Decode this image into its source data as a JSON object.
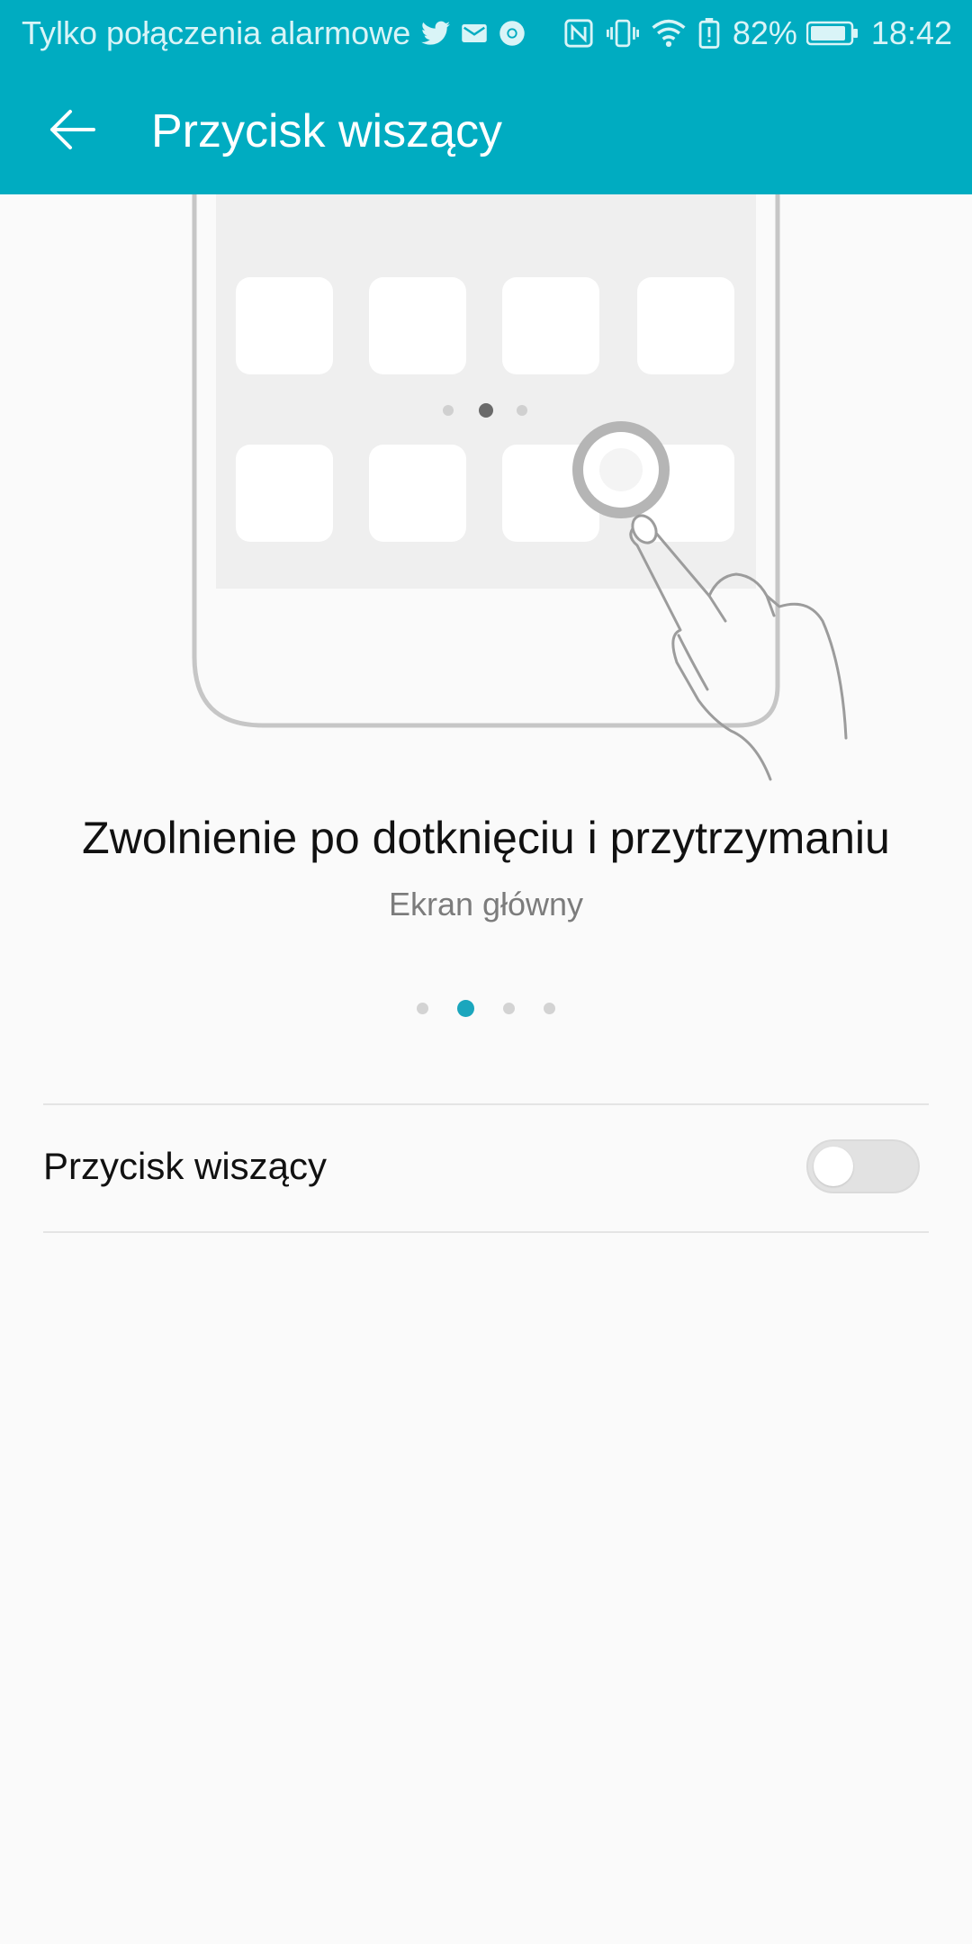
{
  "status_bar": {
    "carrier_text": "Tylko połączenia alarmowe",
    "battery_text": "82%",
    "time": "18:42",
    "left_icons": [
      "twitter-icon",
      "mail-icon",
      "chrome-icon"
    ],
    "right_icons": [
      "nfc-icon",
      "vibrate-icon",
      "wifi-icon",
      "battery-alert-icon",
      "battery-icon"
    ]
  },
  "app_bar": {
    "title": "Przycisk wiszący",
    "back_icon": "arrow-back-icon",
    "color": "#00acc1"
  },
  "intro": {
    "headline": "Zwolnienie po dotknięciu i przytrzymaniu",
    "subline": "Ekran główny",
    "pages": 4,
    "active_page": 2,
    "illustration_pages": 3,
    "illustration_active_page": 2
  },
  "setting": {
    "label": "Przycisk wiszący",
    "enabled": false
  },
  "colors": {
    "accent": "#1ba6bd",
    "background": "#fafafa"
  }
}
